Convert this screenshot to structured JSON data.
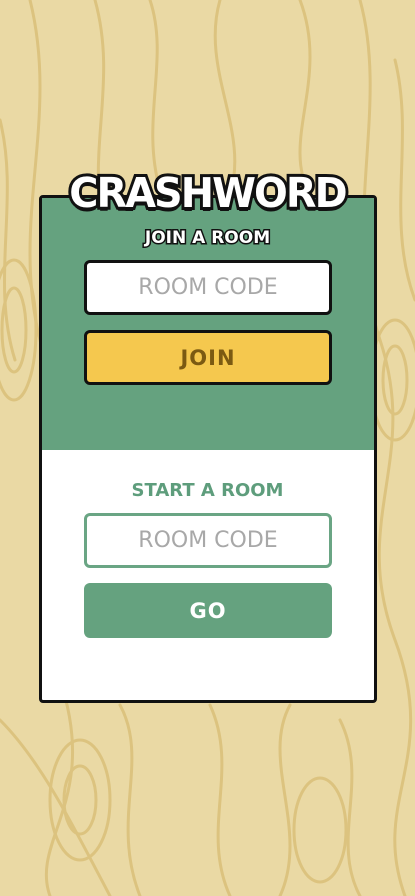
{
  "app": {
    "logo_text": "CRASHWORD"
  },
  "join_section": {
    "heading": "JOIN A ROOM",
    "room_code_placeholder": "ROOM CODE",
    "join_label": "JOIN"
  },
  "start_section": {
    "heading": "START A ROOM",
    "room_code_placeholder": "ROOM CODE",
    "go_label": "GO"
  },
  "colors": {
    "background": "#ead9a4",
    "wood_grain": "#dcc37f",
    "primary_green": "#65a27f",
    "join_yellow": "#f5c84e",
    "join_text": "#7b5a12",
    "outline": "#111111"
  }
}
